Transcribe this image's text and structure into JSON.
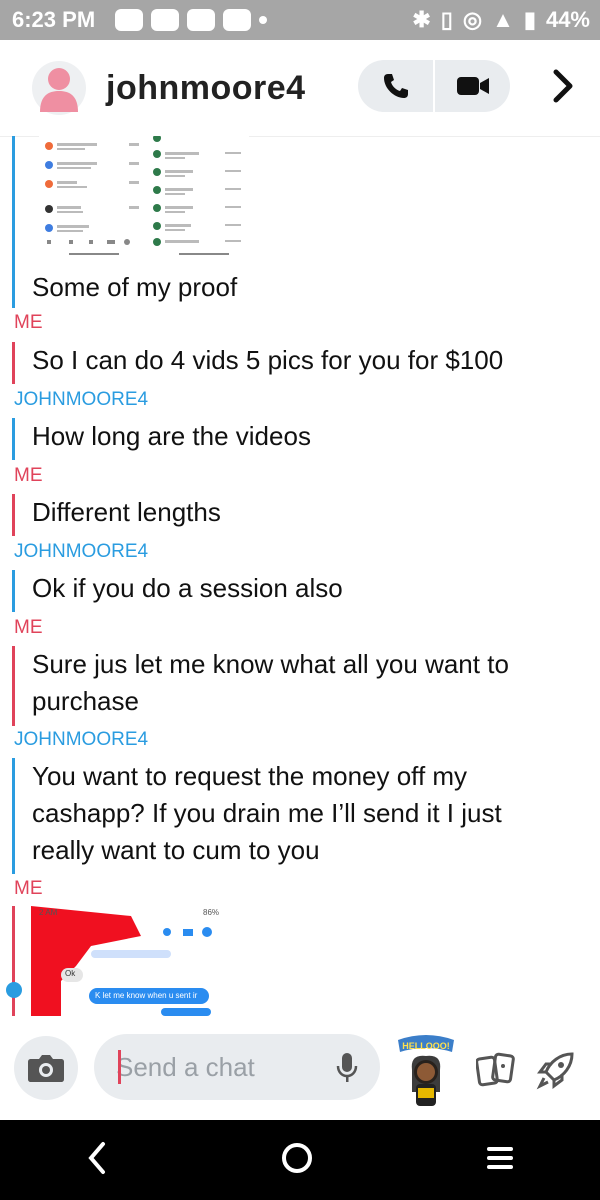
{
  "status_bar": {
    "time": "6:23 PM",
    "battery": "44%"
  },
  "header": {
    "username": "johnmoore4"
  },
  "messages": [
    {
      "sender": "",
      "text": "Some of my proof"
    },
    {
      "sender": "ME",
      "text": "So I can do 4 vids 5 pics for you for $100"
    },
    {
      "sender": "JOHNMOORE4",
      "text": "How long are the videos"
    },
    {
      "sender": "ME",
      "text": "Different lengths"
    },
    {
      "sender": "JOHNMOORE4",
      "text": "Ok if you do a session also"
    },
    {
      "sender": "ME",
      "text": "Sure jus let me know what all you want to purchase"
    },
    {
      "sender": "JOHNMOORE4",
      "text": "You want to request the money off my cashapp? If you drain me I’ll send it I just really want to cum to you"
    },
    {
      "sender": "ME",
      "text": ""
    }
  ],
  "screenshot_preview": {
    "time_fragment": "2 AM",
    "battery": "86%",
    "bubble_ok": "Ok",
    "bubble_blue": "K let me know when u sent ir"
  },
  "composer": {
    "placeholder": "Send a chat"
  },
  "bitmoji_sticker_text": "HELLOOO!",
  "colors": {
    "me": "#e0435a",
    "them": "#2a9ce0"
  }
}
